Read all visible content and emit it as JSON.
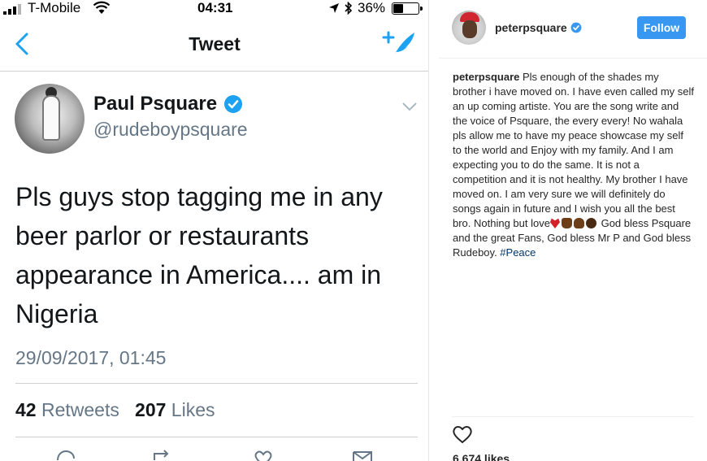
{
  "phone": {
    "status": {
      "carrier": "T-Mobile",
      "time": "04:31",
      "battery": "36%",
      "battery_level": 0.36
    },
    "nav": {
      "title": "Tweet"
    },
    "tweet": {
      "author_name": "Paul Psquare",
      "author_handle": "@rudeboypsquare",
      "text": "Pls guys stop tagging me in any beer parlor or restaurants appearance in America.... am in Nigeria",
      "date": "29/09/2017, 01:45",
      "retweets_count": "42",
      "retweets_label": "Retweets",
      "likes_count": "207",
      "likes_label": "Likes"
    },
    "icons": [
      "back-icon",
      "compose-icon",
      "verified-icon",
      "chevron-down-icon",
      "reply-icon",
      "retweet-icon",
      "like-icon",
      "message-icon"
    ]
  },
  "instagram": {
    "username": "peterpsquare",
    "follow_label": "Follow",
    "caption_part1": "Pls enough of the shades my brother i have moved on. I have even called my self an up coming artiste. You are the song write and the voice of Psquare, the every every! No wahala pls allow me to have my peace showcase my self to the world and Enjoy with my family. And I am expecting you to do the same. It is not a competition and it is not healthy. My brother I have moved on. I am very sure we will definitely do songs again in future and I wish you all the best bro. Nothing but love",
    "caption_part2": " God bless Psquare and the great Fans, God bless Mr P and God bless Rudeboy. ",
    "hashtag": "#Peace",
    "likes": "6,674 likes",
    "colors": {
      "accent": "#3897f0",
      "hashtag": "#003569"
    }
  }
}
